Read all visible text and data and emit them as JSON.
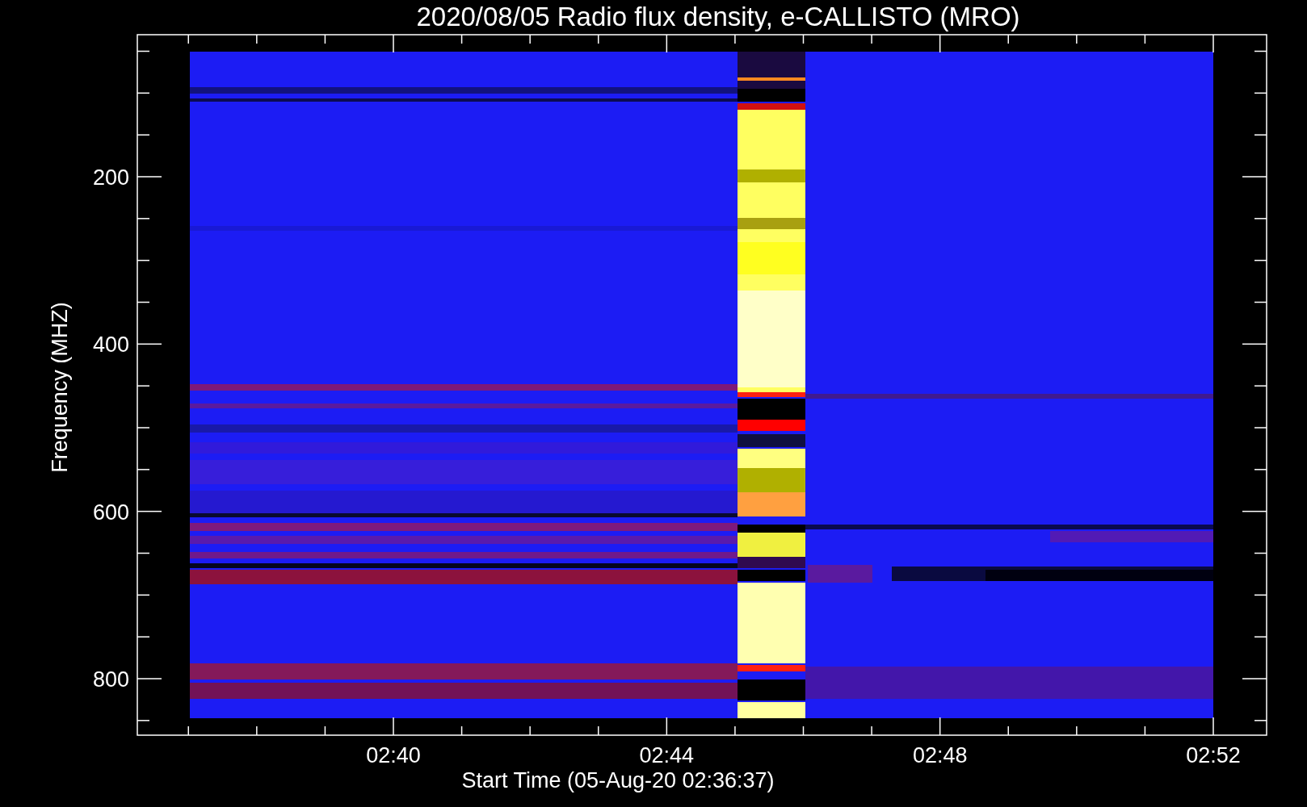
{
  "title": "2020/08/05  Radio flux density, e-CALLISTO (MRO)",
  "x_axis": {
    "title": "Start Time (05-Aug-20 02:36:37)",
    "ticks": [
      "02:40",
      "02:44",
      "02:48",
      "02:52"
    ]
  },
  "y_axis": {
    "title": "Frequency (MHZ)",
    "ticks": [
      "200",
      "400",
      "600",
      "800"
    ]
  }
}
